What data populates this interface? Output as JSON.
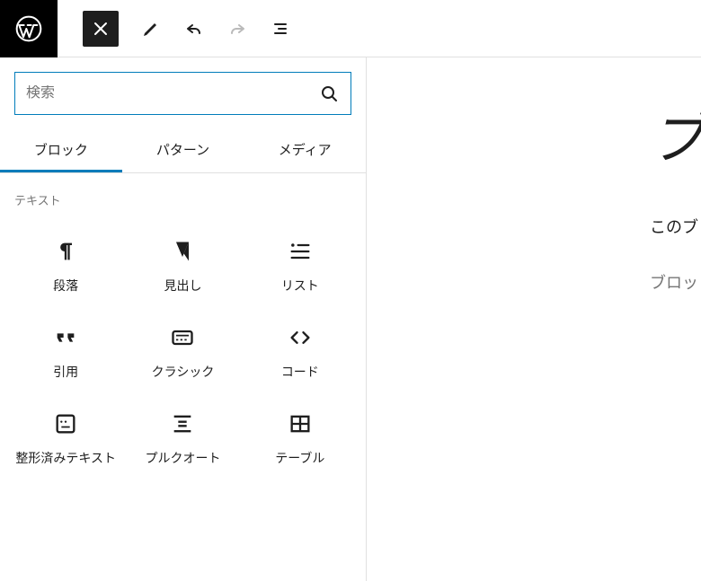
{
  "search": {
    "placeholder": "検索"
  },
  "tabs": {
    "t0": "ブロック",
    "t1": "パターン",
    "t2": "メディア"
  },
  "category": {
    "label": "テキスト"
  },
  "blocks": {
    "b0": "段落",
    "b1": "見出し",
    "b2": "リスト",
    "b3": "引用",
    "b4": "クラシック",
    "b5": "コード",
    "b6": "整形済みテキスト",
    "b7": "プルクオート",
    "b8": "テーブル"
  },
  "editor": {
    "title": "ブ",
    "paragraph": "このブ",
    "placeholder": "ブロッ"
  }
}
